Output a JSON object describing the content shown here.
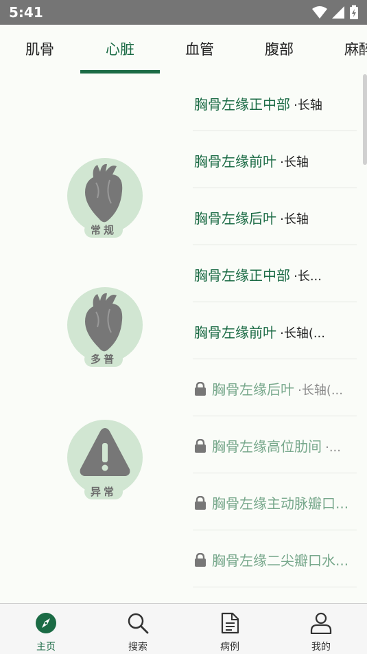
{
  "status_bar": {
    "time": "5:41"
  },
  "tabs": [
    {
      "label": "肌骨"
    },
    {
      "label": "心脏"
    },
    {
      "label": "血管"
    },
    {
      "label": "腹部"
    },
    {
      "label": "麻醉"
    }
  ],
  "active_tab": "心脏",
  "categories": [
    {
      "label": "常规",
      "icon": "heart-icon"
    },
    {
      "label": "多普",
      "icon": "heart-icon"
    },
    {
      "label": "异常",
      "icon": "warning-icon"
    }
  ],
  "list": [
    {
      "title": "胸骨左缘正中部",
      "sub": "·长轴",
      "locked": false
    },
    {
      "title": "胸骨左缘前叶",
      "sub": "·长轴",
      "locked": false
    },
    {
      "title": "胸骨左缘后叶",
      "sub": "·长轴",
      "locked": false
    },
    {
      "title": "胸骨左缘正中部",
      "sub": "·长...",
      "locked": false
    },
    {
      "title": "胸骨左缘前叶",
      "sub": "·长轴(...",
      "locked": false
    },
    {
      "title": "胸骨左缘后叶",
      "sub": "·长轴(...",
      "locked": true
    },
    {
      "title": "胸骨左缘高位肋间",
      "sub": "·...",
      "locked": true
    },
    {
      "title": "胸骨左缘主动脉瓣口...",
      "sub": "",
      "locked": true
    },
    {
      "title": "胸骨左缘二尖瓣口水...",
      "sub": "",
      "locked": true
    }
  ],
  "bottom_nav": [
    {
      "label": "主页",
      "icon": "compass-icon"
    },
    {
      "label": "搜索",
      "icon": "search-icon"
    },
    {
      "label": "病例",
      "icon": "document-icon"
    },
    {
      "label": "我的",
      "icon": "person-icon"
    }
  ],
  "colors": {
    "accent": "#1b6b45",
    "category_bg": "#d1e6d2",
    "locked": "#78a88c"
  }
}
